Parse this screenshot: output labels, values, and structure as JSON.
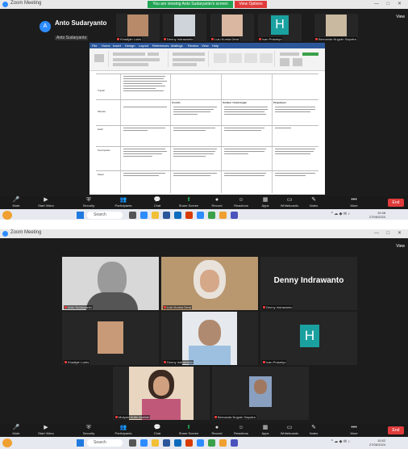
{
  "top": {
    "window_title": "Zoom Meeting",
    "share_banner": "You are viewing Anto Sudaryanto's screen",
    "stop_button": "View Options",
    "view_button": "View",
    "window_controls": "— □ ✕",
    "presenter_name": "Anto Sudaryanto",
    "presenter_initial": "A",
    "presenter_tag": "Anto Sudaryanto",
    "thumbs": [
      {
        "label": "Khadijah Lubis"
      },
      {
        "label": "Denny Indrawanto"
      },
      {
        "label": "Lulu Kurnia Dewi"
      },
      {
        "label": "Ivan Prasetyo",
        "initial": "H"
      },
      {
        "label": "Bernanda Nugrah Saputra"
      }
    ],
    "doc_tabs": [
      "File",
      "Home",
      "Insert",
      "Design",
      "Layout",
      "References",
      "Mailings",
      "Review",
      "View",
      "Help"
    ],
    "doc_col_headers": [
      "Deskripsi",
      "Contoh",
      "Sumber / Keterangan",
      "Penjelasan"
    ],
    "doc_rows": [
      "Tujuan",
      "Metode",
      "Hasil",
      "Kesimpulan",
      "Saran"
    ],
    "toolbar": [
      {
        "icon": "microphone-icon",
        "glyph": "🎤",
        "label": "Mute"
      },
      {
        "icon": "video-icon",
        "glyph": "▶",
        "label": "Start Video"
      },
      {
        "icon": "shield-icon",
        "glyph": "⛨",
        "label": "Security"
      },
      {
        "icon": "participants-icon",
        "glyph": "👥",
        "label": "Participants"
      },
      {
        "icon": "chat-icon",
        "glyph": "💬",
        "label": "Chat"
      },
      {
        "icon": "share-icon",
        "glyph": "⬆",
        "label": "Share Screen"
      },
      {
        "icon": "record-icon",
        "glyph": "●",
        "label": "Record"
      },
      {
        "icon": "reactions-icon",
        "glyph": "☺",
        "label": "Reactions"
      },
      {
        "icon": "apps-icon",
        "glyph": "▦",
        "label": "Apps"
      },
      {
        "icon": "whiteboard-icon",
        "glyph": "▭",
        "label": "Whiteboards"
      },
      {
        "icon": "notes-icon",
        "glyph": "✎",
        "label": "Notes"
      },
      {
        "icon": "more-icon",
        "glyph": "•••",
        "label": "More"
      }
    ],
    "end_button": "End",
    "taskbar": {
      "search": "Search",
      "time": "10:48",
      "date": "27/06/2024"
    }
  },
  "bottom": {
    "window_title": "Zoom Meeting",
    "view_button": "View",
    "window_controls": "— □ ✕",
    "tiles": [
      {
        "label": "Anto Sudaryanto"
      },
      {
        "label": "Lulu Kurnia Dewi"
      },
      {
        "label": "Denny Indrawanto",
        "bigname": "Denny Indrawanto"
      },
      {
        "label": "Khadijah Lubis"
      },
      {
        "label": "Denny Indrawanto"
      },
      {
        "label": "Ivan Prasetyo",
        "initial": "H"
      },
      {
        "label": "Mulyani Aulia Jamilah"
      },
      {
        "label": "Bernanda Nugrah Saputra"
      }
    ],
    "end_button": "End",
    "taskbar": {
      "search": "Search",
      "time": "10:52",
      "date": "27/06/2024"
    }
  },
  "colors": {
    "accent": "#2d8cff",
    "share_green": "#23a455",
    "end_red": "#e03b3b",
    "teal_avatar": "#1ba0a0",
    "active_speaker": "#a8d040"
  }
}
